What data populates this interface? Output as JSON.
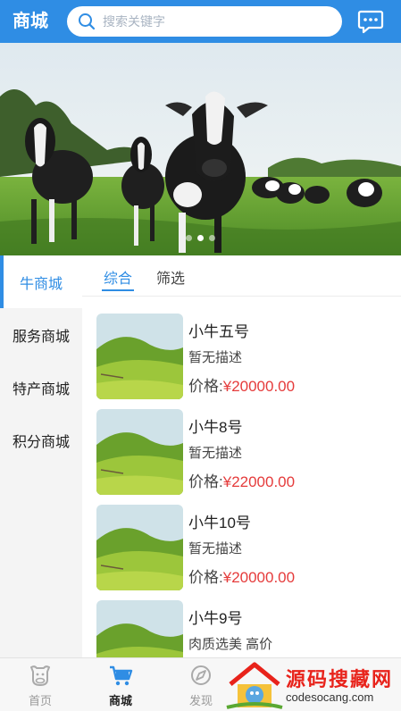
{
  "header": {
    "title": "商城",
    "search_placeholder": "搜索关键字",
    "search_icon": "search-icon",
    "message_icon": "chat-bubble-icon"
  },
  "banner": {
    "slide_count": 3,
    "active_index": 1
  },
  "sidebar": {
    "items": [
      {
        "label": "牛商城",
        "active": true
      },
      {
        "label": "服务商城",
        "active": false
      },
      {
        "label": "特产商城",
        "active": false
      },
      {
        "label": "积分商城",
        "active": false
      }
    ]
  },
  "filters": {
    "tabs": [
      {
        "label": "综合",
        "active": true
      },
      {
        "label": "筛选",
        "active": false
      }
    ]
  },
  "products": [
    {
      "name": "小牛五号",
      "desc": "暂无描述",
      "price_label": "价格:",
      "price": "¥20000.00"
    },
    {
      "name": "小牛8号",
      "desc": "暂无描述",
      "price_label": "价格:",
      "price": "¥22000.00"
    },
    {
      "name": "小牛10号",
      "desc": "暂无描述",
      "price_label": "价格:",
      "price": "¥20000.00"
    },
    {
      "name": "小牛9号",
      "desc": "肉质选美 高价",
      "price_label": "",
      "price": ""
    }
  ],
  "bottom_nav": {
    "items": [
      {
        "label": "首页",
        "icon": "cow-head-icon",
        "active": false
      },
      {
        "label": "商城",
        "icon": "shopping-cart-icon",
        "active": true
      },
      {
        "label": "发现",
        "icon": "compass-icon",
        "active": false
      }
    ]
  },
  "watermark": {
    "text": "源码搜藏网",
    "url": "codesocang.com"
  },
  "colors": {
    "accent": "#2f8de4",
    "price": "#e53b3b",
    "sidebar_bg": "#f4f4f4"
  }
}
